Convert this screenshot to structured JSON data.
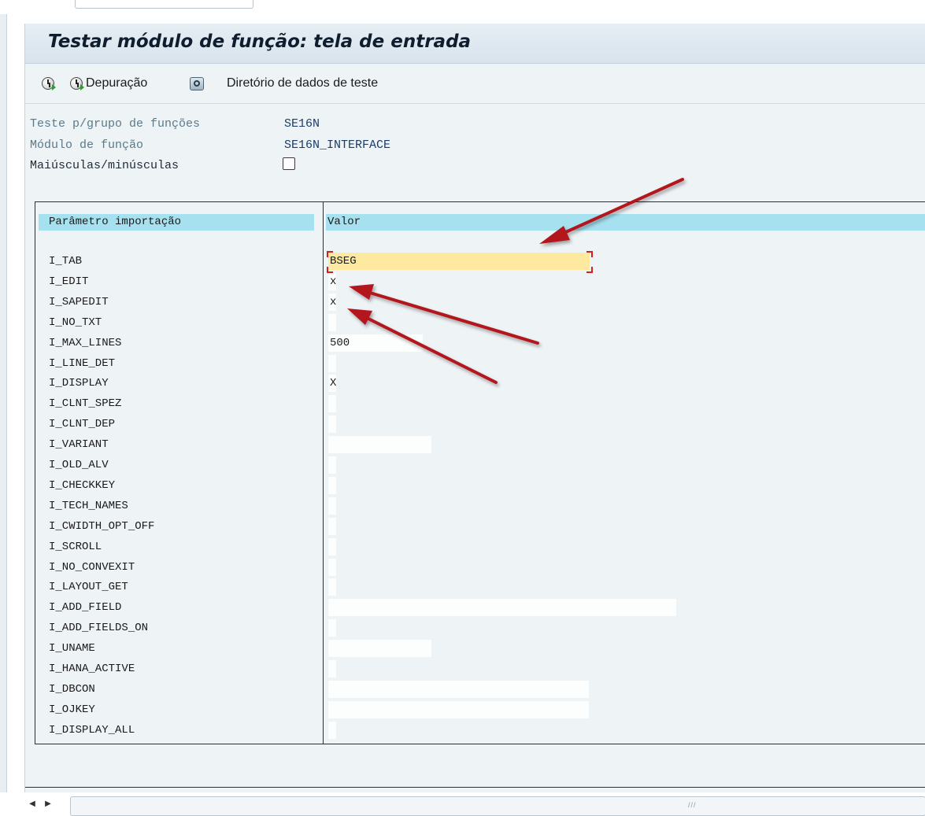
{
  "title": "Testar módulo de função: tela de entrada",
  "toolbar": {
    "depuracao_label": "Depuração",
    "diretorio_label": "Diretório de dados de teste"
  },
  "meta": {
    "grupo_label": "Teste p/grupo de funções",
    "grupo_value": "SE16N",
    "modulo_label": "Módulo de função",
    "modulo_value": "SE16N_INTERFACE",
    "maiusculas_label": "Maiúsculas/minúsculas",
    "maiusculas_checked": false
  },
  "table": {
    "header_param": "Parâmetro importação",
    "header_value": "Valor",
    "rows": [
      {
        "name": "I_TAB",
        "value": "BSEG"
      },
      {
        "name": "I_EDIT",
        "value": "x"
      },
      {
        "name": "I_SAPEDIT",
        "value": "x"
      },
      {
        "name": "I_NO_TXT",
        "value": ""
      },
      {
        "name": "I_MAX_LINES",
        "value": "500"
      },
      {
        "name": "I_LINE_DET",
        "value": ""
      },
      {
        "name": "I_DISPLAY",
        "value": "X"
      },
      {
        "name": "I_CLNT_SPEZ",
        "value": ""
      },
      {
        "name": "I_CLNT_DEP",
        "value": ""
      },
      {
        "name": "I_VARIANT",
        "value": ""
      },
      {
        "name": "I_OLD_ALV",
        "value": ""
      },
      {
        "name": "I_CHECKKEY",
        "value": ""
      },
      {
        "name": "I_TECH_NAMES",
        "value": ""
      },
      {
        "name": "I_CWIDTH_OPT_OFF",
        "value": ""
      },
      {
        "name": "I_SCROLL",
        "value": ""
      },
      {
        "name": "I_NO_CONVEXIT",
        "value": ""
      },
      {
        "name": "I_LAYOUT_GET",
        "value": ""
      },
      {
        "name": "I_ADD_FIELD",
        "value": ""
      },
      {
        "name": "I_ADD_FIELDS_ON",
        "value": ""
      },
      {
        "name": "I_UNAME",
        "value": ""
      },
      {
        "name": "I_HANA_ACTIVE",
        "value": ""
      },
      {
        "name": "I_DBCON",
        "value": ""
      },
      {
        "name": "I_OJKEY",
        "value": ""
      },
      {
        "name": "I_DISPLAY_ALL",
        "value": ""
      }
    ]
  },
  "statusbar": {
    "left_arrow": "◀",
    "right_arrow": "▶",
    "grip": "///"
  },
  "colors": {
    "header_bg": "#a6e1ef",
    "focused_field": "#fde9a0",
    "annotation_arrow": "#b3141a"
  },
  "icons": [
    "execute-icon",
    "debug-execute-icon",
    "test-data-directory-icon",
    "red-annotation-arrow"
  ]
}
